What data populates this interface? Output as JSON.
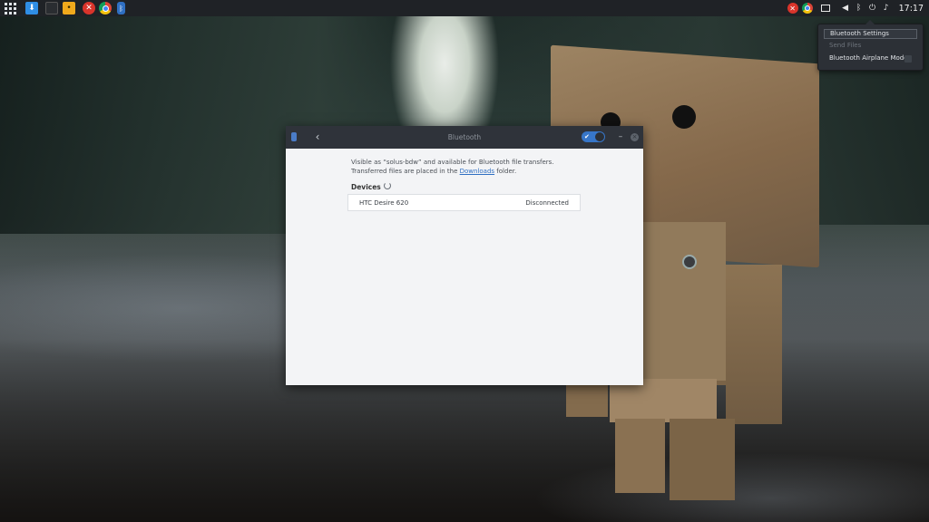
{
  "panel": {
    "clock": "17:17",
    "launcher_icons": [
      "apps-grid-icon",
      "download-icon",
      "terminal-icon",
      "file-manager-icon",
      "crossover-icon",
      "chrome-icon",
      "bluetooth-icon"
    ],
    "tray_icons": [
      "crossover-icon",
      "chrome-icon",
      "notification-icon",
      "volume-icon",
      "bluetooth-icon",
      "power-icon",
      "bell-icon"
    ]
  },
  "popover": {
    "items": [
      {
        "label": "Bluetooth Settings",
        "state": "highlighted"
      },
      {
        "label": "Send Files",
        "state": "disabled"
      },
      {
        "label": "Bluetooth Airplane Mode",
        "state": "normal"
      }
    ]
  },
  "window": {
    "title": "Bluetooth",
    "back_glyph": "‹",
    "switch_check": "✔",
    "minimize_glyph": "–",
    "close_glyph": "×",
    "description_before": "Visible as “solus-bdw” and available for Bluetooth file transfers. Transferred files are placed in the ",
    "downloads_link": "Downloads",
    "description_after": " folder.",
    "devices_label": "Devices",
    "devices": [
      {
        "name": "HTC Desire 620",
        "status": "Disconnected"
      }
    ],
    "bluetooth_enabled": true,
    "accent_color": "#3776c8"
  }
}
